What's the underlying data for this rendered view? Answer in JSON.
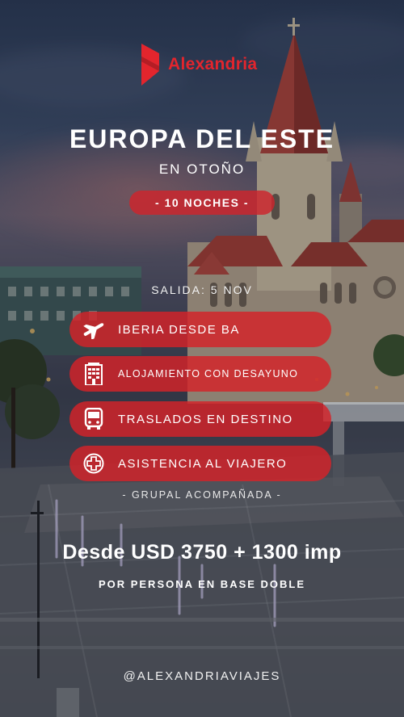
{
  "brand": {
    "name": "Alexandria",
    "color": "#e3252d"
  },
  "hero": {
    "title": "EUROPA DEL ESTE",
    "subtitle": "EN OTOÑO",
    "nights": "- 10 NOCHES -"
  },
  "departure": "SALIDA: 5 NOV",
  "features": [
    {
      "icon": "airplane-icon",
      "label": "IBERIA DESDE BA"
    },
    {
      "icon": "hotel-icon",
      "label": "ALOJAMIENTO CON DESAYUNO"
    },
    {
      "icon": "bus-icon",
      "label": "TRASLADOS EN DESTINO"
    },
    {
      "icon": "medical-cross-icon",
      "label": "ASISTENCIA AL VIAJERO"
    }
  ],
  "group_note": "- GRUPAL ACOMPAÑADA -",
  "price": {
    "text": "Desde USD 3750 + 1300 imp",
    "note": "POR PERSONA EN BASE DOBLE"
  },
  "social_handle": "@ALEXANDRIAVIAJES",
  "colors": {
    "pill": "#d62228",
    "text": "#ffffff"
  }
}
